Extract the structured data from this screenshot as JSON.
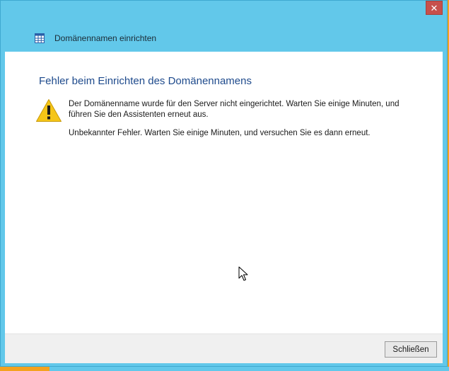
{
  "window": {
    "title": "Domänennamen einrichten",
    "app_icon": "table-icon",
    "close_label": "✕"
  },
  "content": {
    "heading": "Fehler beim Einrichten des Domänennamens",
    "icon": "warning-icon",
    "message1": "Der Domänenname wurde für den Server nicht eingerichtet. Warten Sie einige Minuten, und führen Sie den Assistenten erneut aus.",
    "message2": "Unbekannter Fehler. Warten Sie einige Minuten, und versuchen Sie es dann erneut."
  },
  "footer": {
    "close_button": "Schließen"
  },
  "colors": {
    "frame": "#62c8ea",
    "heading": "#1e4a8c",
    "warning": "#f5c518",
    "desktop": "#f4a21f"
  }
}
